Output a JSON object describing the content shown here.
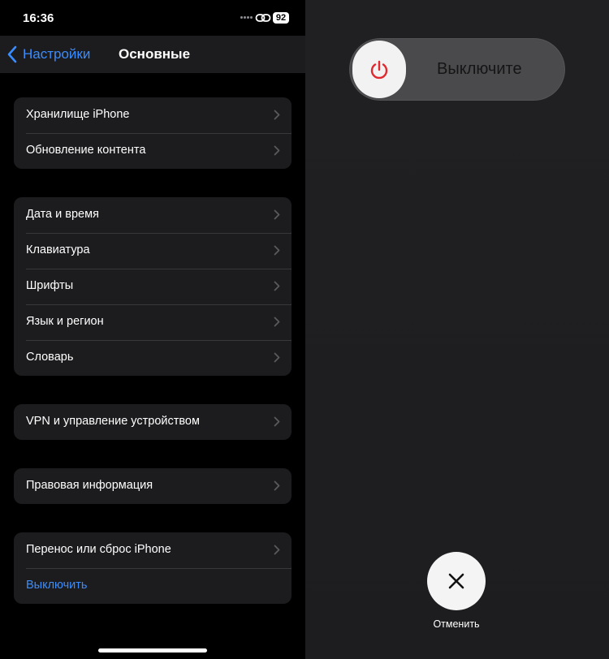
{
  "status_bar": {
    "time": "16:36",
    "battery": "92",
    "icons": [
      "more-dots-icon",
      "link-icon",
      "battery-icon"
    ]
  },
  "nav": {
    "back_label": "Настройки",
    "title": "Основные"
  },
  "groups": [
    {
      "items": [
        {
          "label": "Хранилище iPhone",
          "chevron": true
        },
        {
          "label": "Обновление контента",
          "chevron": true
        }
      ]
    },
    {
      "items": [
        {
          "label": "Дата и время",
          "chevron": true
        },
        {
          "label": "Клавиатура",
          "chevron": true
        },
        {
          "label": "Шрифты",
          "chevron": true
        },
        {
          "label": "Язык и регион",
          "chevron": true
        },
        {
          "label": "Словарь",
          "chevron": true
        }
      ]
    },
    {
      "items": [
        {
          "label": "VPN и управление устройством",
          "chevron": true
        }
      ]
    },
    {
      "items": [
        {
          "label": "Правовая информация",
          "chevron": true
        }
      ]
    },
    {
      "items": [
        {
          "label": "Перенос или сброс iPhone",
          "chevron": true
        },
        {
          "label": "Выключить",
          "chevron": false
        }
      ]
    }
  ],
  "power_overlay": {
    "slider_label": "Выключите",
    "knob_icon": "power-icon",
    "cancel_icon": "close-icon",
    "cancel_label": "Отменить"
  },
  "colors": {
    "accent": "#3a8dff",
    "power_red": "#e0282e",
    "cell_background": "#1c1c1e",
    "separator": "#38383a"
  }
}
